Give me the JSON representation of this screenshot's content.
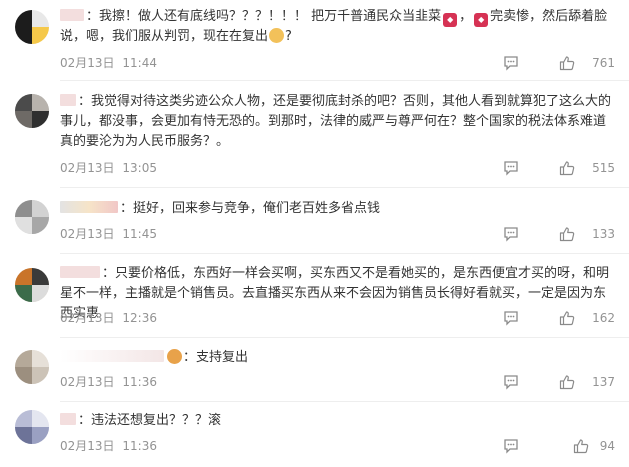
{
  "comments": [
    {
      "text_a": "我擦！做人还有底线吗？？？！！！ 把万千普通民众当韭菜",
      "text_b": "完卖惨，然后舔着脸说，嗯，我们服从判罚，现在在复出",
      "text_c": "?",
      "date": "02月13日",
      "time": "11:44",
      "likes": "761"
    },
    {
      "text_a": "我觉得对待这类劣迹公众人物，还是要彻底封杀的吧？否则，其他人看到就算犯了这么大的事儿，都没事，会更加有恃无恐的。到那时，法律的威严与尊严何在？整个国家的税法体系难道真的要沦为为人民币服务？。",
      "date": "02月13日",
      "time": "13:05",
      "likes": "515"
    },
    {
      "text_a": "挺好，回来参与竞争，俺们老百姓多省点钱",
      "date": "02月13日",
      "time": "11:45",
      "likes": "133"
    },
    {
      "text_a": "只要价格低，东西好一样会买啊，买东西又不是看她买的，是东西便宜才买的呀，和明星不一样，主播就是个销售员。去直播买东西从来不会因为销售员长得好看就买，一定是因为东西实惠",
      "date": "02月13日",
      "time": "12:36",
      "likes": "162"
    },
    {
      "text_a": "支持复出",
      "date": "02月13日",
      "time": "11:36",
      "likes": "137"
    },
    {
      "text_a": "违法还想复出？？？滚",
      "date": "02月13日",
      "time": "11:36",
      "likes": "94"
    }
  ],
  "icons": {
    "reply": "reply-icon",
    "like": "thumbs-up-icon",
    "tag": "weibo-tag-icon",
    "emoji": "dog-face-emoji-icon"
  },
  "colors": {
    "text": "#333333",
    "meta": "#939393",
    "tag": "#d63254"
  }
}
